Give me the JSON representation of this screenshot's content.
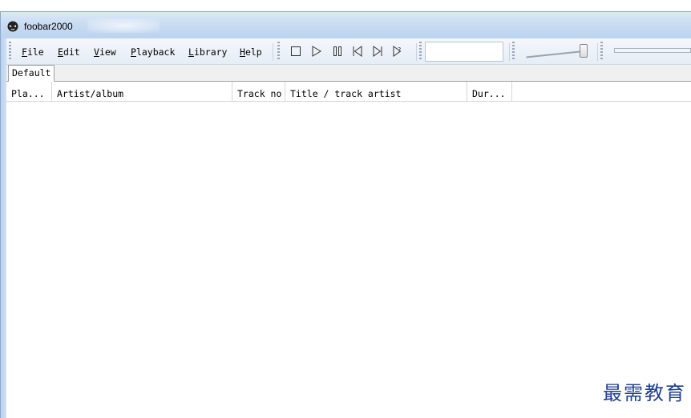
{
  "window": {
    "title": "foobar2000"
  },
  "menu": [
    {
      "label": "File",
      "mnemonic": "F",
      "rest": "ile"
    },
    {
      "label": "Edit",
      "mnemonic": "E",
      "rest": "dit"
    },
    {
      "label": "View",
      "mnemonic": "V",
      "rest": "iew"
    },
    {
      "label": "Playback",
      "mnemonic": "P",
      "rest": "layback"
    },
    {
      "label": "Library",
      "mnemonic": "L",
      "rest": "ibrary"
    },
    {
      "label": "Help",
      "mnemonic": "H",
      "rest": "elp"
    }
  ],
  "toolbar": {
    "buttons": [
      "stop-icon",
      "play-icon",
      "pause-icon",
      "previous-icon",
      "next-icon",
      "random-icon"
    ]
  },
  "playlist_tabs": [
    {
      "label": "Default"
    }
  ],
  "columns": [
    "Pla...",
    "Artist/album",
    "Track no",
    "Title / track artist",
    "Dur..."
  ],
  "watermark": "最需教育"
}
